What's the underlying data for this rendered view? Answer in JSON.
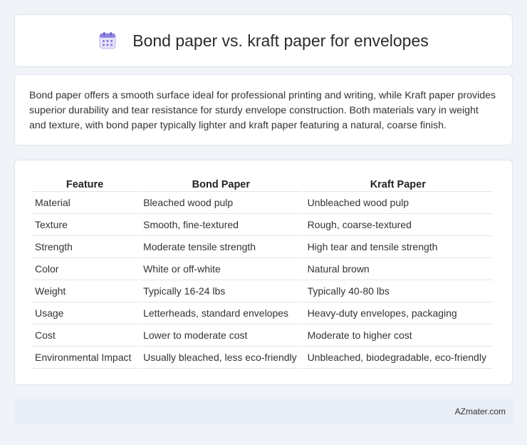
{
  "header": {
    "icon": "calendar-icon",
    "title": "Bond paper vs. kraft paper for envelopes"
  },
  "description": "Bond paper offers a smooth surface ideal for professional printing and writing, while Kraft paper provides superior durability and tear resistance for sturdy envelope construction. Both materials vary in weight and texture, with bond paper typically lighter and kraft paper featuring a natural, coarse finish.",
  "table": {
    "headers": [
      "Feature",
      "Bond Paper",
      "Kraft Paper"
    ],
    "rows": [
      [
        "Material",
        "Bleached wood pulp",
        "Unbleached wood pulp"
      ],
      [
        "Texture",
        "Smooth, fine-textured",
        "Rough, coarse-textured"
      ],
      [
        "Strength",
        "Moderate tensile strength",
        "High tear and tensile strength"
      ],
      [
        "Color",
        "White or off-white",
        "Natural brown"
      ],
      [
        "Weight",
        "Typically 16-24 lbs",
        "Typically 40-80 lbs"
      ],
      [
        "Usage",
        "Letterheads, standard envelopes",
        "Heavy-duty envelopes, packaging"
      ],
      [
        "Cost",
        "Lower to moderate cost",
        "Moderate to higher cost"
      ],
      [
        "Environmental Impact",
        "Usually bleached, less eco-friendly",
        "Unbleached, biodegradable, eco-friendly"
      ]
    ]
  },
  "footer": {
    "site": "AZmater.com"
  },
  "colors": {
    "background": "#f0f3f8",
    "card": "#ffffff",
    "footer_bg": "#e8edf6",
    "icon_accent": "#7b6fd6"
  }
}
